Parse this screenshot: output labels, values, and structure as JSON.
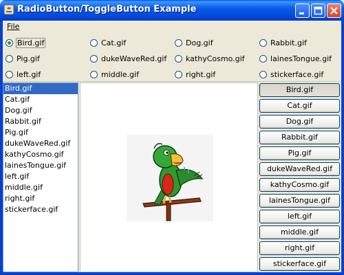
{
  "window": {
    "title": "RadioButton/ToggleButton Example"
  },
  "menu": {
    "file": "File"
  },
  "images": [
    "Bird.gif",
    "Cat.gif",
    "Dog.gif",
    "Rabbit.gif",
    "Pig.gif",
    "dukeWaveRed.gif",
    "kathyCosmo.gif",
    "lainesTongue.gif",
    "left.gif",
    "middle.gif",
    "right.gif",
    "stickerface.gif"
  ],
  "radios": [
    {
      "label": "Bird.gif",
      "selected": true
    },
    {
      "label": "Cat.gif",
      "selected": false
    },
    {
      "label": "Dog.gif",
      "selected": false
    },
    {
      "label": "Rabbit.gif",
      "selected": false
    },
    {
      "label": "Pig.gif",
      "selected": false
    },
    {
      "label": "dukeWaveRed.gif",
      "selected": false
    },
    {
      "label": "kathyCosmo.gif",
      "selected": false
    },
    {
      "label": "lainesTongue.gif",
      "selected": false
    },
    {
      "label": "left.gif",
      "selected": false
    },
    {
      "label": "middle.gif",
      "selected": false
    },
    {
      "label": "right.gif",
      "selected": false
    },
    {
      "label": "stickerface.gif",
      "selected": false
    }
  ],
  "list": {
    "selected_index": 0,
    "items": [
      "Bird.gif",
      "Cat.gif",
      "Dog.gif",
      "Rabbit.gif",
      "Pig.gif",
      "dukeWaveRed.gif",
      "kathyCosmo.gif",
      "lainesTongue.gif",
      "left.gif",
      "middle.gif",
      "right.gif",
      "stickerface.gif"
    ]
  },
  "toggles": {
    "pressed_index": 0,
    "items": [
      "Bird.gif",
      "Cat.gif",
      "Dog.gif",
      "Rabbit.gif",
      "Pig.gif",
      "dukeWaveRed.gif",
      "kathyCosmo.gif",
      "lainesTongue.gif",
      "left.gif",
      "middle.gif",
      "right.gif",
      "stickerface.gif"
    ]
  },
  "preview": {
    "image": "parrot-image"
  },
  "colors": {
    "titlebar": "#0a5ae8",
    "selection": "#316ac5",
    "radio_dot": "#2a9a2a"
  }
}
